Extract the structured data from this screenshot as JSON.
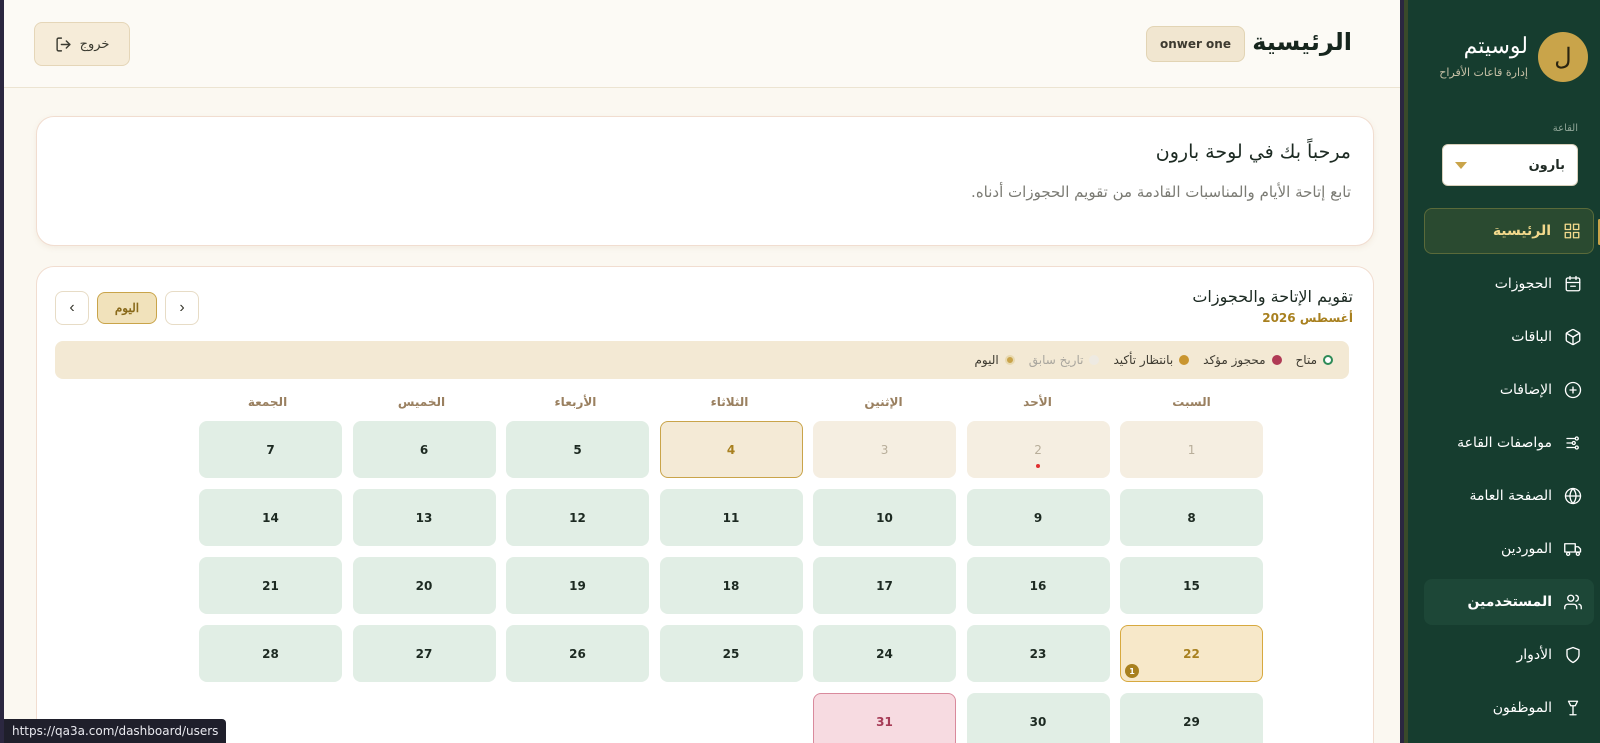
{
  "sidebar": {
    "brand": {
      "avatar_letter": "ل",
      "name": "لوسيتم",
      "subtitle": "إدارة قاعات الأفراح"
    },
    "hall_label": "القاعة",
    "hall_value": "بارون",
    "items": [
      {
        "label": "الرئيسية",
        "icon": "grid-icon",
        "state": "active"
      },
      {
        "label": "الحجوزات",
        "icon": "calendar-icon",
        "state": ""
      },
      {
        "label": "الباقات",
        "icon": "box-icon",
        "state": ""
      },
      {
        "label": "الإضافات",
        "icon": "plus-circle-icon",
        "state": ""
      },
      {
        "label": "مواصفات القاعة",
        "icon": "sliders-icon",
        "state": ""
      },
      {
        "label": "الصفحة العامة",
        "icon": "globe-icon",
        "state": ""
      },
      {
        "label": "الموردين",
        "icon": "truck-icon",
        "state": ""
      },
      {
        "label": "المستخدمين",
        "icon": "users-icon",
        "state": "hover"
      },
      {
        "label": "الأدوار",
        "icon": "shield-icon",
        "state": ""
      },
      {
        "label": "الموظفون",
        "icon": "staff-icon",
        "state": ""
      }
    ]
  },
  "topbar": {
    "title": "الرئيسية",
    "user": "onwer one",
    "logout": "خروج"
  },
  "welcome": {
    "title": "مرحباً بك في لوحة بارون",
    "subtitle": "تابع إتاحة الأيام والمناسبات القادمة من تقويم الحجوزات أدناه."
  },
  "calendar": {
    "title": "تقويم الإتاحة والحجوزات",
    "month": "أغسطس 2026",
    "today_button": "اليوم",
    "legend": [
      {
        "label": "متاح",
        "color": "#ffffff",
        "border": "#2e8b57"
      },
      {
        "label": "محجوز مؤكد",
        "color": "#b03a55",
        "border": "#b03a55"
      },
      {
        "label": "بانتظار تأكيد",
        "color": "#c9952f",
        "border": "#c9952f"
      },
      {
        "label": "تاريخ سابق",
        "color": "#eeeae2",
        "border": "#eeeae2"
      },
      {
        "label": "اليوم",
        "color": "#c9a44a",
        "border": "#e8d9b0"
      }
    ],
    "weekdays": [
      "السبت",
      "الأحد",
      "الإثنين",
      "الثلاثاء",
      "الأربعاء",
      "الخميس",
      "الجمعة"
    ],
    "days": [
      {
        "n": "1",
        "s": "past"
      },
      {
        "n": "2",
        "s": "past",
        "dot": true
      },
      {
        "n": "3",
        "s": "past"
      },
      {
        "n": "4",
        "s": "today"
      },
      {
        "n": "5",
        "s": "available"
      },
      {
        "n": "6",
        "s": "available"
      },
      {
        "n": "7",
        "s": "available"
      },
      {
        "n": "8",
        "s": "available"
      },
      {
        "n": "9",
        "s": "available"
      },
      {
        "n": "10",
        "s": "available"
      },
      {
        "n": "11",
        "s": "available"
      },
      {
        "n": "12",
        "s": "available"
      },
      {
        "n": "13",
        "s": "available"
      },
      {
        "n": "14",
        "s": "available"
      },
      {
        "n": "15",
        "s": "available"
      },
      {
        "n": "16",
        "s": "available"
      },
      {
        "n": "17",
        "s": "available"
      },
      {
        "n": "18",
        "s": "available"
      },
      {
        "n": "19",
        "s": "available"
      },
      {
        "n": "20",
        "s": "available"
      },
      {
        "n": "21",
        "s": "available"
      },
      {
        "n": "22",
        "s": "pending",
        "count": "1"
      },
      {
        "n": "23",
        "s": "available"
      },
      {
        "n": "24",
        "s": "available"
      },
      {
        "n": "25",
        "s": "available"
      },
      {
        "n": "26",
        "s": "available"
      },
      {
        "n": "27",
        "s": "available"
      },
      {
        "n": "28",
        "s": "available"
      },
      {
        "n": "29",
        "s": "available"
      },
      {
        "n": "30",
        "s": "available"
      },
      {
        "n": "31",
        "s": "confirmed"
      }
    ]
  },
  "status_url": "https://qa3a.com/dashboard/users"
}
